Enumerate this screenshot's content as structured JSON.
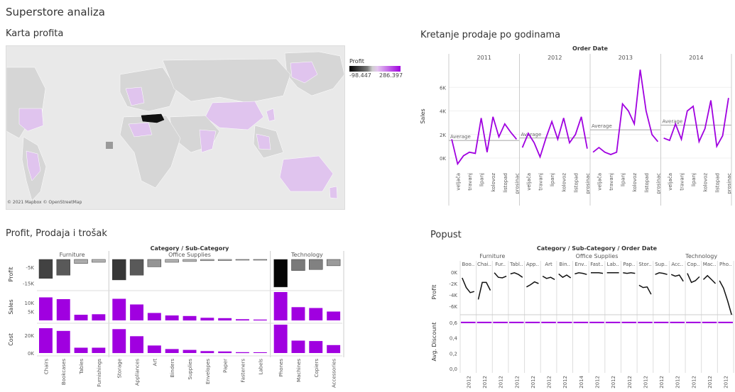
{
  "dashboard_title": "Superstore analiza",
  "map": {
    "title": "Karta profita",
    "legend_title": "Profit",
    "legend_min": "-98.447",
    "legend_max": "286.397",
    "credit": "© 2021 Mapbox © OpenStreetMap",
    "colors": {
      "ocean": "#e9e9e9",
      "land": "#d6d6d6",
      "highlight_low": "#e0c4ee",
      "negative": "#111111"
    }
  },
  "line_section_title": "Kretanje prodaje po godinama",
  "bars_section_title": "Profit, Prodaja i trošak",
  "discount_section_title": "Popust",
  "chart_data": [
    {
      "type": "line",
      "title": "Order Date",
      "ylabel": "Sales",
      "ylim": [
        -900,
        8000
      ],
      "yticks": [
        "0K",
        "2K",
        "4K",
        "6K"
      ],
      "ytick_values": [
        0,
        2000,
        4000,
        6000
      ],
      "average_label": "Average",
      "month_labels": [
        "veljača",
        "travanj",
        "lipanj",
        "kolovoz",
        "listopad",
        "prosinac"
      ],
      "color": "#a000e0",
      "panels": [
        {
          "year": "2011",
          "average": 1500,
          "values": [
            1600,
            -500,
            200,
            500,
            400,
            3400,
            500,
            3500,
            1800,
            2900,
            2200,
            1600
          ]
        },
        {
          "year": "2012",
          "average": 1700,
          "values": [
            900,
            2100,
            1300,
            100,
            1700,
            3100,
            1600,
            3400,
            1300,
            2000,
            3500,
            800
          ]
        },
        {
          "year": "2013",
          "average": 2400,
          "values": [
            500,
            900,
            500,
            300,
            500,
            4600,
            4000,
            2900,
            7500,
            4000,
            2000,
            1400
          ]
        },
        {
          "year": "2014",
          "average": 2800,
          "values": [
            1700,
            1500,
            2900,
            1600,
            4000,
            4400,
            1400,
            2500,
            4900,
            1000,
            1900,
            5100
          ]
        }
      ]
    },
    {
      "type": "bar",
      "title": "Category / Sub-Category",
      "categories_groups": [
        {
          "name": "Furniture",
          "subs": [
            "Chairs",
            "Bookcases",
            "Tables",
            "Furnishings"
          ]
        },
        {
          "name": "Office Supplies",
          "subs": [
            "Storage",
            "Appliances",
            "Art",
            "Binders",
            "Supplies",
            "Envelopes",
            "Paper",
            "Fasteners",
            "Labels"
          ]
        },
        {
          "name": "Technology",
          "subs": [
            "Phones",
            "Machines",
            "Copiers",
            "Accessories"
          ]
        }
      ],
      "rows": [
        {
          "label": "Profit",
          "ticks": [
            "-5K",
            "-15K"
          ],
          "tick_values": [
            -5000,
            -15000
          ],
          "range": [
            -18000,
            0
          ],
          "values": [
            -12000,
            -10000,
            -2500,
            -1800,
            -13000,
            -10000,
            -4700,
            -1800,
            -1300,
            -800,
            -700,
            -300,
            -400,
            -17500,
            -7000,
            -6400,
            -4000
          ]
        },
        {
          "label": "Sales",
          "ticks": [
            "10K",
            "5K"
          ],
          "tick_values": [
            10000,
            5000
          ],
          "range": [
            0,
            16000
          ],
          "values": [
            13000,
            12000,
            3200,
            3500,
            12200,
            9000,
            4200,
            2800,
            2500,
            1500,
            1300,
            700,
            500,
            16000,
            7500,
            7000,
            5000
          ]
        },
        {
          "label": "Cost",
          "ticks": [
            "20K",
            "0K"
          ],
          "tick_values": [
            20000,
            0
          ],
          "range": [
            0,
            32000
          ],
          "values": [
            28000,
            25000,
            6000,
            6000,
            27000,
            19000,
            8500,
            4500,
            3500,
            2200,
            1800,
            1000,
            900,
            32000,
            14000,
            13500,
            9000
          ]
        }
      ]
    },
    {
      "type": "line",
      "title": "Category / Sub-Category / Order Date",
      "groups": [
        {
          "name": "Furniture",
          "subs": [
            "Boo..",
            "Chai..",
            "Fur..",
            "Tabl.."
          ]
        },
        {
          "name": "Office Supplies",
          "subs": [
            "App..",
            "Art",
            "Bin..",
            "Env..",
            "Fast..",
            "Lab..",
            "Pap..",
            "Stor..",
            "Sup.."
          ]
        },
        {
          "name": "Technology",
          "subs": [
            "Acc..",
            "Cop..",
            "Mac..",
            "Pho.."
          ]
        }
      ],
      "profit_axis": {
        "label": "Profit",
        "ticks": [
          "0K",
          "-2K",
          "-4K",
          "-6K"
        ],
        "tick_values": [
          0,
          -2000,
          -4000,
          -6000
        ],
        "range": [
          -7500,
          500
        ]
      },
      "discount_axis": {
        "label": "Avg. Discount",
        "ticks": [
          "0,6",
          "0,4",
          "0,2",
          "0,0"
        ],
        "tick_values": [
          0.6,
          0.4,
          0.2,
          0.0
        ],
        "range": [
          0,
          0.7
        ]
      },
      "profit_series": [
        [
          -1000,
          -2700,
          -3600,
          -3400
        ],
        [
          -4800,
          -1800,
          -1800,
          -3200
        ],
        [
          -100,
          -900,
          -1000,
          -700
        ],
        [
          -300,
          -100,
          -400,
          -900
        ],
        [
          -2600,
          -2200,
          -1700,
          -2000
        ],
        [
          -700,
          -1100,
          -900,
          -1300
        ],
        [
          -300,
          -900,
          -500,
          -1000
        ],
        [
          -300,
          -100,
          -200,
          -400
        ],
        [
          -100,
          -100,
          -100,
          -200
        ],
        [
          -100,
          -100,
          -100,
          -100
        ],
        [
          -100,
          -200,
          -100,
          -200
        ],
        [
          -2300,
          -2700,
          -2600,
          -3900
        ],
        [
          -400,
          -100,
          -200,
          -400
        ],
        [
          -400,
          -700,
          -500,
          -1600
        ],
        [
          -200,
          -1800,
          -1500,
          -800
        ],
        [
          -1300,
          -600,
          -1300,
          -2000
        ],
        [
          -1500,
          -2800,
          -5000,
          -7500
        ]
      ],
      "discount_series_value": 0.6,
      "x_labels": [
        "2012",
        "2012",
        "2012",
        "2012",
        "2012",
        "2012",
        "2012",
        "2014",
        "2012",
        "2012",
        "2012",
        "2012",
        "2012",
        "2012",
        "2012",
        "2012",
        "2012"
      ],
      "colors": {
        "profit": "#111111",
        "discount": "#a000e0"
      }
    }
  ]
}
